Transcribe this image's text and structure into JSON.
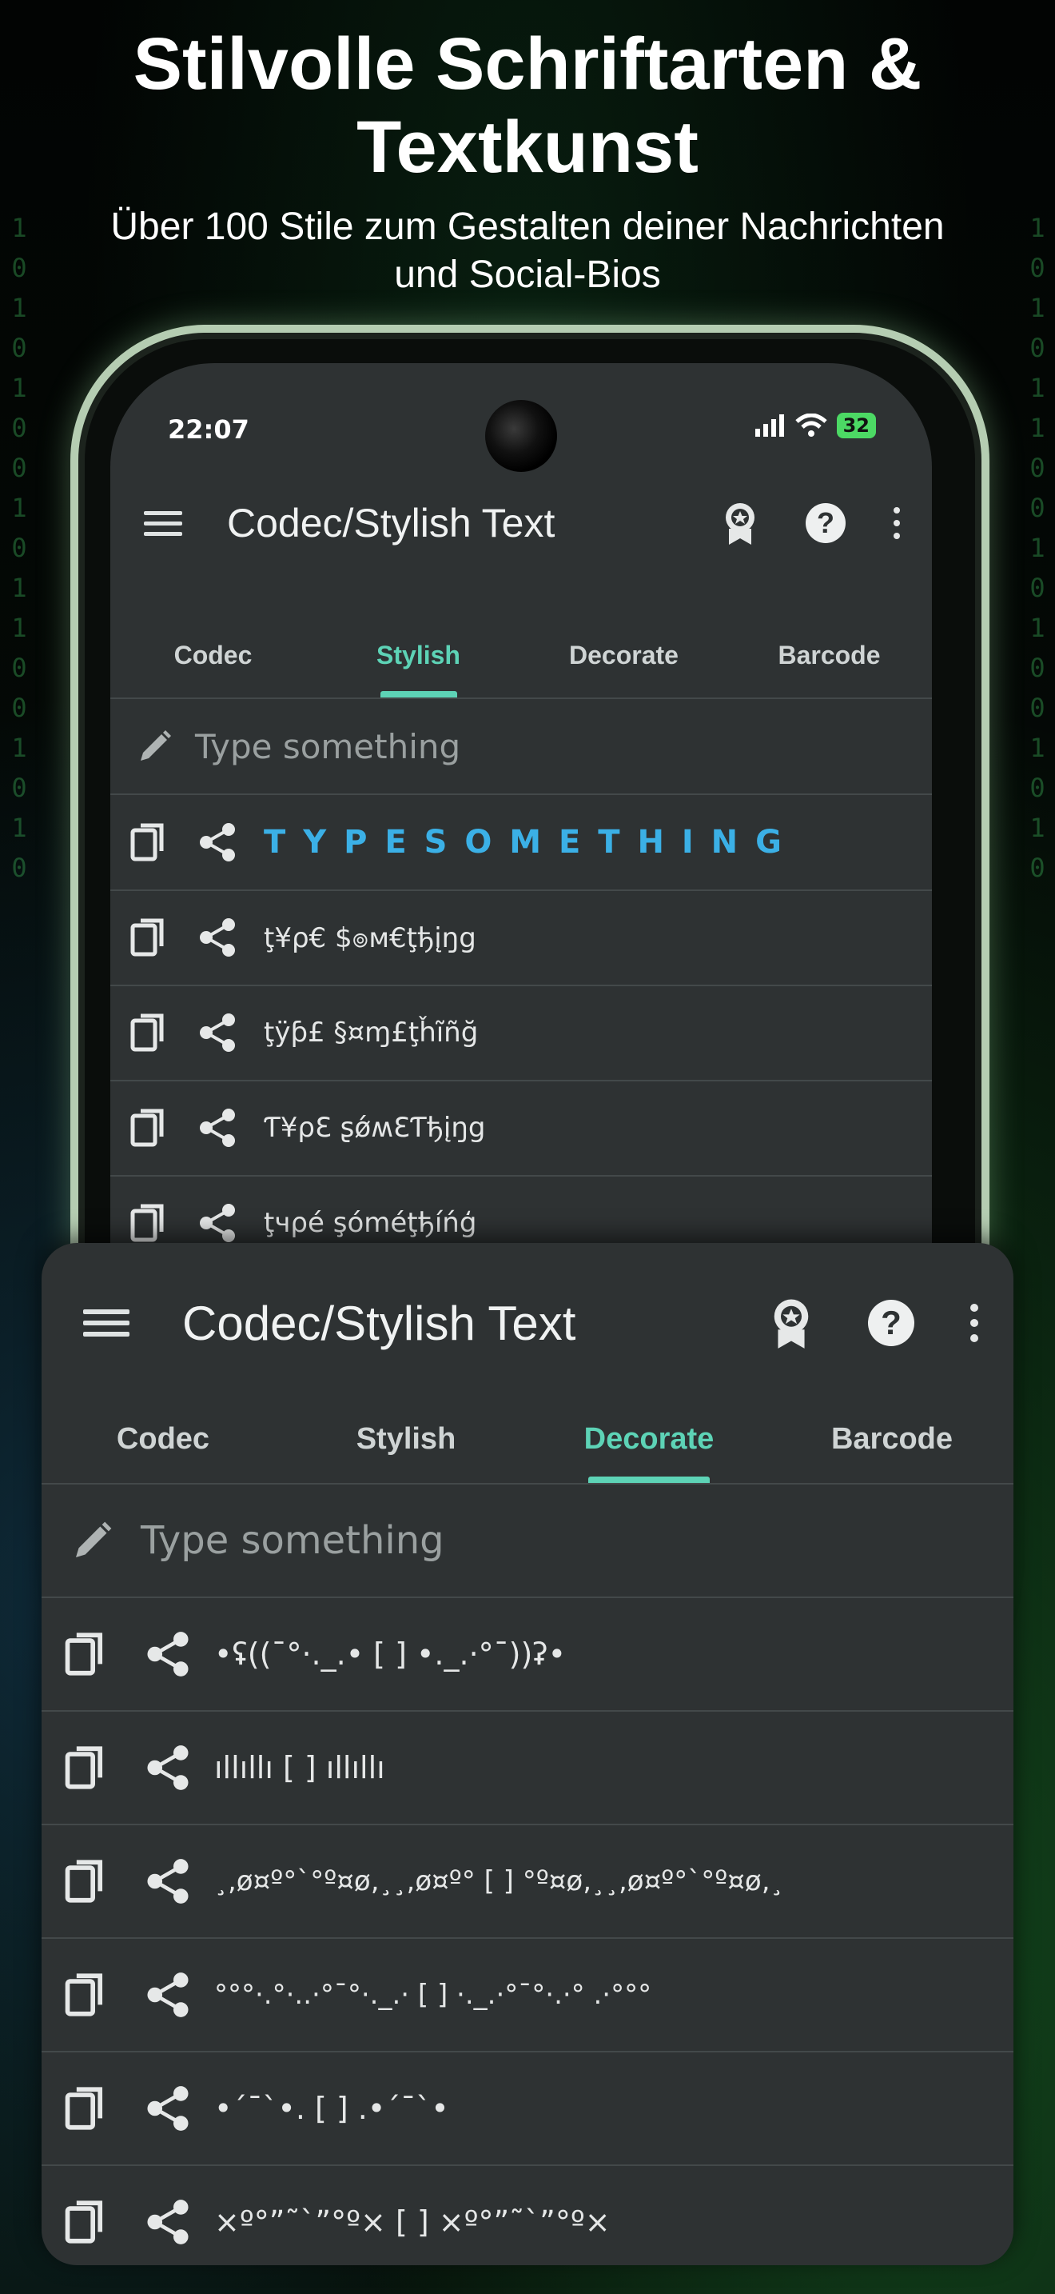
{
  "promo": {
    "headline_line1": "Stilvolle Schriftarten &",
    "headline_line2": "Textkunst",
    "subline_line1": "Über 100 Stile zum Gestalten deiner Nachrichten",
    "subline_line2": "und Social-Bios"
  },
  "status_bar": {
    "time": "22:07",
    "battery": "32"
  },
  "app": {
    "title": "Codec/Stylish Text",
    "tabs": [
      "Codec",
      "Stylish",
      "Decorate",
      "Barcode"
    ],
    "input_placeholder": "Type something"
  },
  "stylish_screen": {
    "active_tab": "Stylish",
    "rows": [
      "T Y P E  S O M E T H I N G",
      "ţ¥ρ€ $๏м€ţђįŋg",
      "ţÿƥ£ §¤ɱ£ţȟĩñğ",
      "Ƭ¥ρƐ ʂǿʍƐƬђįŋg",
      "ţчρé şóméţђíńģ"
    ]
  },
  "decorate_screen": {
    "active_tab": "Decorate",
    "rows": [
      "•ʢ((¯°·._.• [  ] •._.·°¯))ʡ•",
      "ıllıllı [  ] ıllıllı",
      "¸,ø¤º°`°º¤ø,¸¸,ø¤º° [  ] °º¤ø,¸¸,ø¤º°`°º¤ø,¸",
      "°°°·.°·..·°¯°·._.· [  ] ·._.·°¯°·.·° .·°°°",
      "•´¯`•. [  ] .•´¯`•",
      "×º°”˜`”°º× [  ] ×º°”˜`”°º×"
    ]
  },
  "colors": {
    "accent": "#5dd3b6",
    "highlight_row": "#3bb0e6",
    "surface": "#2e3233"
  }
}
